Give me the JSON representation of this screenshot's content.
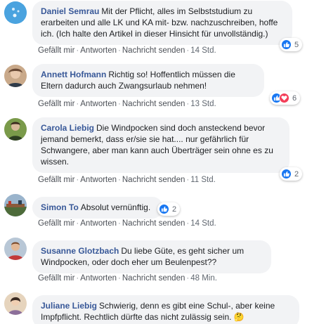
{
  "action_labels": {
    "like": "Gefällt mir",
    "reply": "Antworten",
    "message": "Nachricht senden"
  },
  "separator": "·",
  "comments": [
    {
      "author": "Daniel Semrau",
      "text": "Mit der Pflicht, alles im Selbststudium zu erarbeiten und alle LK und KA mit- bzw. nachzuschreiben, hoffe ich. (Ich halte den Artikel in dieser Hinsicht für unvollständig.)",
      "time": "14 Std.",
      "reactions": {
        "icons": [
          "like-icon"
        ],
        "count": "5"
      },
      "avatar_color": "#4aa3df"
    },
    {
      "author": "Annett Hofmann",
      "text": "Richtig so! Hoffentlich müssen die Eltern dadurch auch Zwangsurlaub nehmen!",
      "time": "13 Std.",
      "reactions": {
        "icons": [
          "like-icon",
          "love-icon"
        ],
        "count": "6"
      },
      "avatar_color": "#b98a6e"
    },
    {
      "author": "Carola Liebig",
      "text": "Die Windpocken sind doch ansteckend bevor jemand bemerkt, dass er/sie sie hat.... nur gefährlich für Schwangere, aber man kann auch Überträger sein ohne es zu wissen.",
      "time": "11 Std.",
      "reactions": {
        "icons": [
          "like-icon"
        ],
        "count": "2"
      },
      "avatar_color": "#4f6b3a"
    },
    {
      "author": "Simon To",
      "text": "Absolut vernünftig.",
      "time": "14 Std.",
      "reactions": {
        "icons": [
          "like-icon"
        ],
        "count": "2"
      },
      "avatar_color": "#6b7f93"
    },
    {
      "author": "Susanne Glotzbach",
      "text": "Du liebe Güte, es geht sicher um Windpocken, oder doch eher um Beulenpest??",
      "time": "48 Min.",
      "reactions": null,
      "avatar_color": "#c23a3a"
    },
    {
      "author": "Juliane Liebig",
      "text": "Schwierig, denn es gibt eine Schul-, aber keine Impfpflicht. Rechtlich dürfte das nicht zulässig sein. 🤔",
      "time": "",
      "reactions": null,
      "avatar_color": "#d8c3a8"
    }
  ],
  "colors": {
    "link": "#385898",
    "bubble": "#f2f3f5",
    "like": "#1877f2",
    "love": "#f33e58",
    "meta": "#606770"
  }
}
